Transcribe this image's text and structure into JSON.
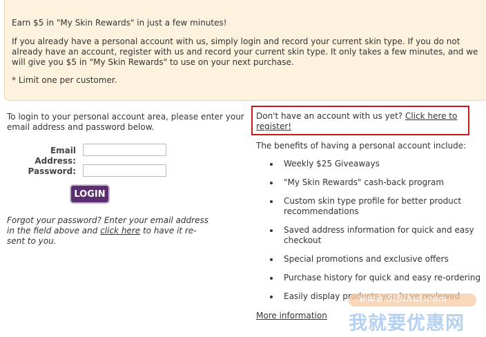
{
  "banner": {
    "headline": "Earn $5 in \"My Skin Rewards\" in just a few minutes!",
    "body": "If you already have a personal account with us, simply login and record your current skin type. If you do not already have an account, register with us and record your current skin type. It only takes a few minutes, and we will give you $5 in \"My Skin Rewards\" to use on your next purchase.",
    "note": "* Limit one per customer."
  },
  "login": {
    "intro": "To login to your personal account area, please enter your email address and password below.",
    "email_label": "Email Address:",
    "email_value": "",
    "password_label": "Password:",
    "password_value": "",
    "button_label": "LOGIN",
    "forgot_prefix": "Forgot your password? Enter your email address in the field above and",
    "forgot_link": "click here",
    "forgot_suffix": "to have it re-sent to you."
  },
  "register": {
    "prompt": "Don't have an account with us yet?",
    "link": "Click here to register!"
  },
  "benefits": {
    "title": "The benefits of having a personal account include:",
    "items": [
      "Weekly $25 Giveaways",
      "\"My Skin Rewards\" cash-back program",
      "Custom skin type profile for better product recommendations",
      "Saved address information for quick and easy checkout",
      "Special promotions and exclusive offers",
      "Purchase history for quick and easy re-ordering",
      "Easily display products you have reviewed"
    ],
    "more_link": "More information"
  },
  "watermark": {
    "url": "www.5i5ihui.com",
    "text": "我就要优惠网"
  }
}
